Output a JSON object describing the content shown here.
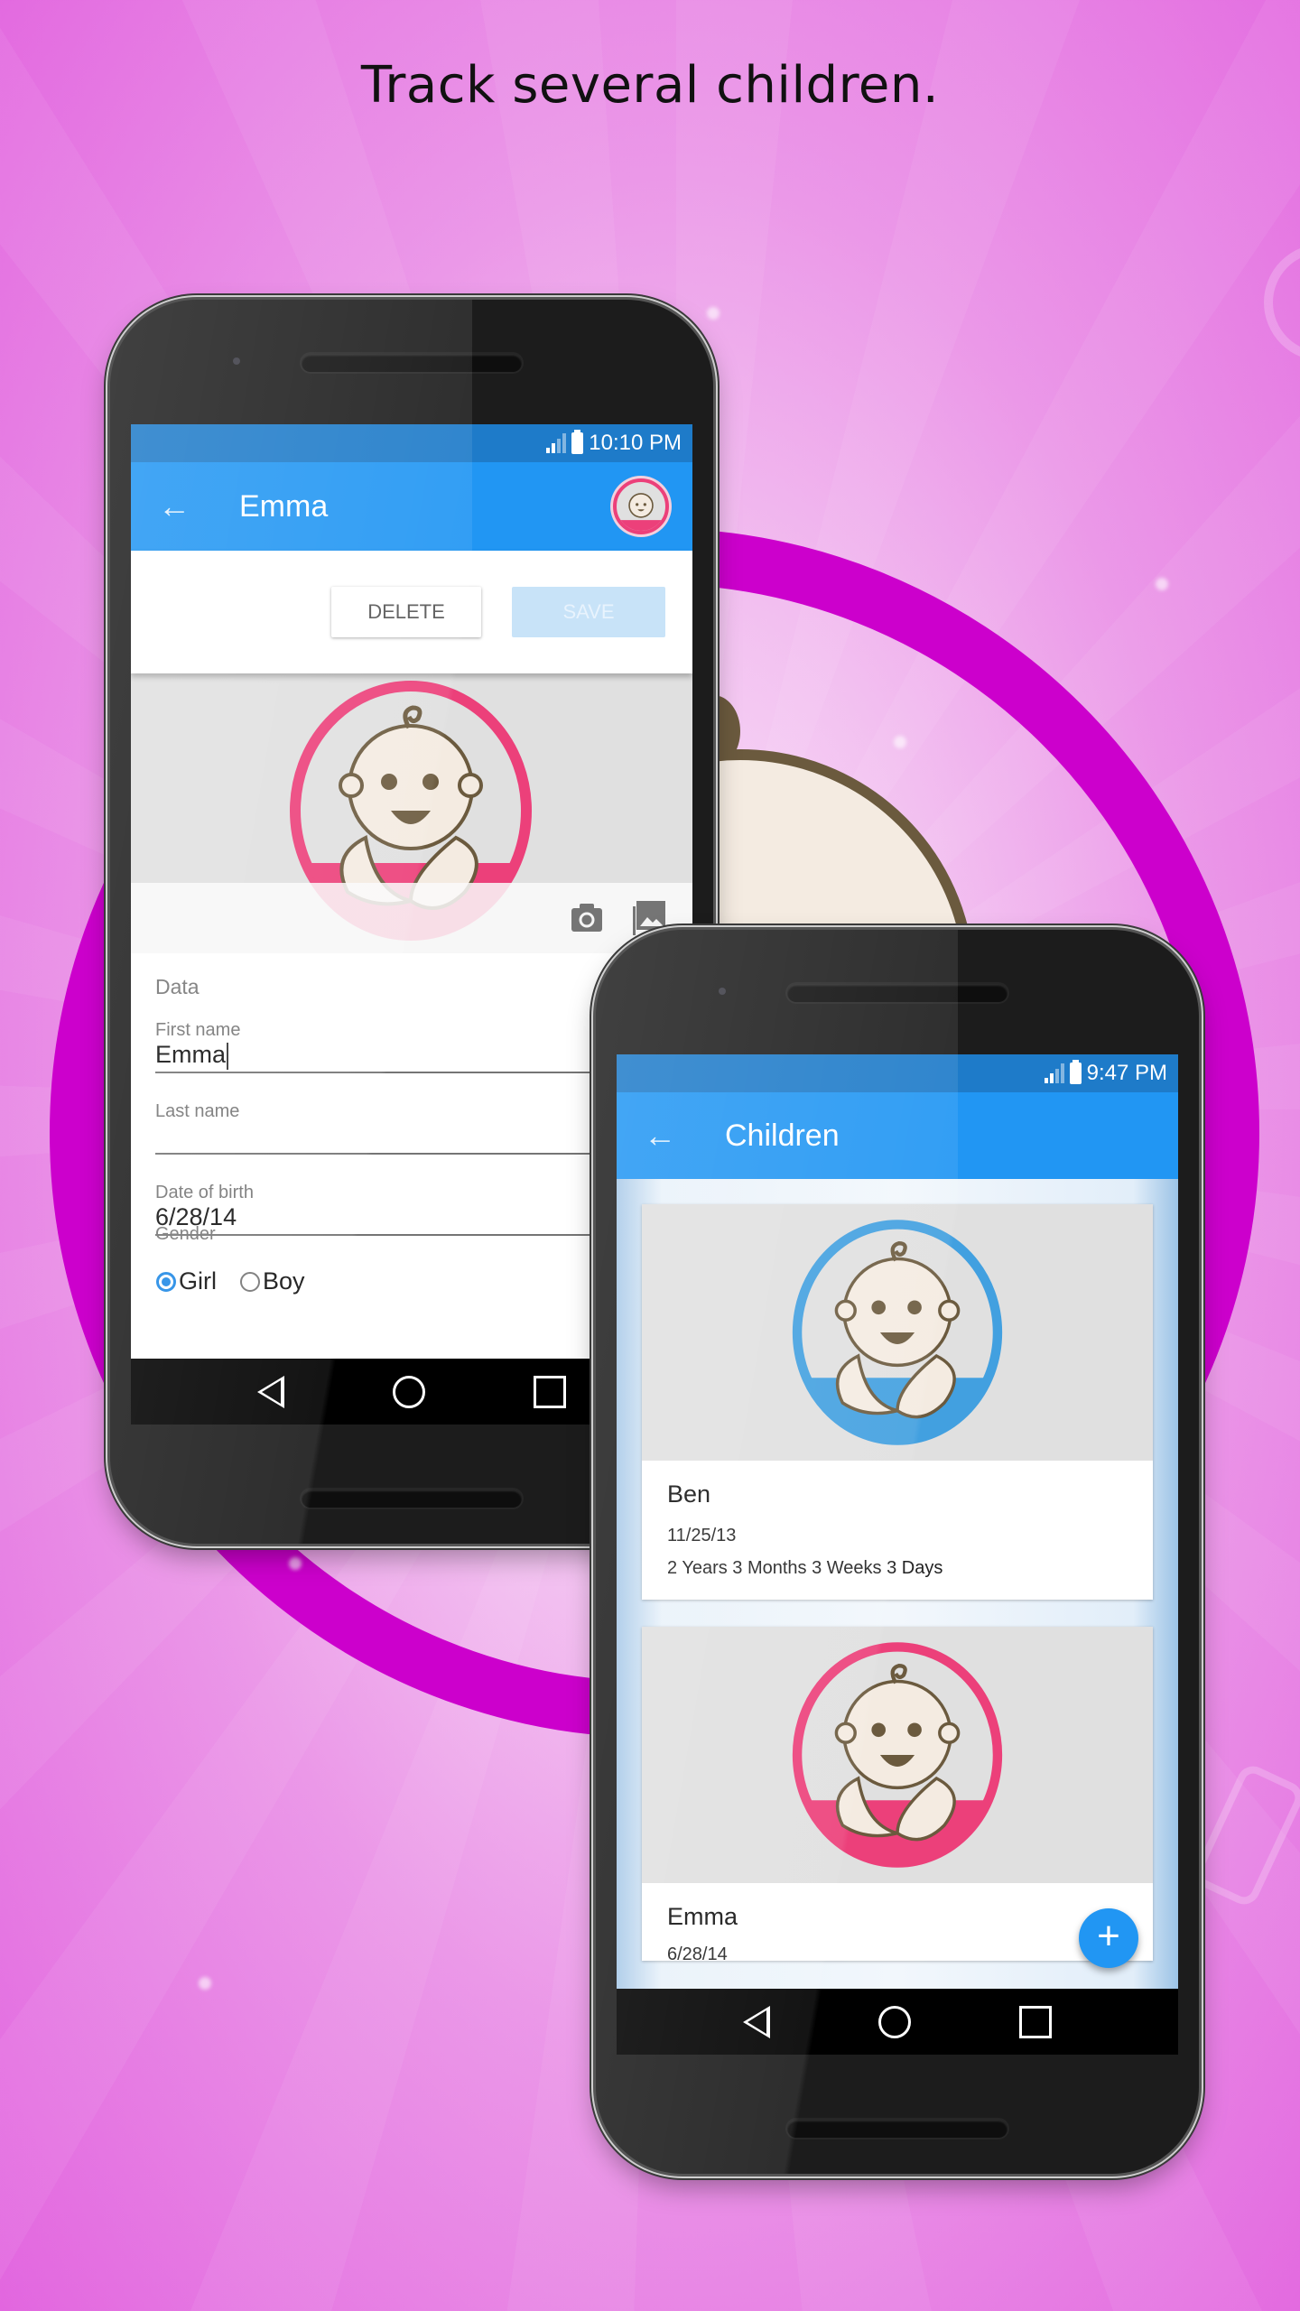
{
  "headline": "Track several children.",
  "colors": {
    "primary": "#2196f3",
    "status_bar": "#1e7bc9",
    "girl_pink": "#ec407a",
    "boy_blue": "#42a0e0",
    "background_magenta": "#cc00cc"
  },
  "phone_edit": {
    "status": {
      "time": "10:10 PM",
      "signal_icon": "signal-icon",
      "battery_icon": "battery-charging-icon"
    },
    "appbar": {
      "back_icon": "arrow-back-icon",
      "title": "Emma",
      "avatar_icon": "baby-avatar-pink"
    },
    "actions": {
      "delete_label": "DELETE",
      "save_label": "SAVE"
    },
    "photo": {
      "camera_icon": "camera-icon",
      "gallery_icon": "image-icon"
    },
    "form": {
      "section": "Data",
      "first_name": {
        "label": "First name",
        "value": "Emma"
      },
      "last_name": {
        "label": "Last name",
        "value": ""
      },
      "date_of_birth": {
        "label": "Date of birth",
        "value": "6/28/14"
      },
      "gender": {
        "label": "Gender",
        "options": [
          {
            "label": "Girl",
            "selected": true
          },
          {
            "label": "Boy",
            "selected": false
          }
        ]
      }
    }
  },
  "phone_list": {
    "status": {
      "time": "9:47 PM"
    },
    "appbar": {
      "back_icon": "arrow-back-icon",
      "title": "Children"
    },
    "children": [
      {
        "name": "Ben",
        "dob": "11/25/13",
        "age": "2 Years 3 Months 3 Weeks 3 Days",
        "avatar": "baby-avatar-blue"
      },
      {
        "name": "Emma",
        "dob": "6/28/14",
        "age": "",
        "avatar": "baby-avatar-pink"
      }
    ],
    "fab_label": "+"
  },
  "navbar": {
    "back": "nav-back-icon",
    "home": "nav-home-icon",
    "recent": "nav-recents-icon"
  }
}
